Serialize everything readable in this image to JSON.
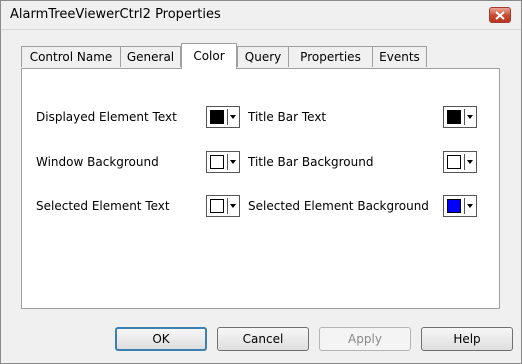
{
  "window": {
    "title": "AlarmTreeViewerCtrl2 Properties"
  },
  "tabs": [
    {
      "label": "Control Name"
    },
    {
      "label": "General"
    },
    {
      "label": "Color"
    },
    {
      "label": "Query"
    },
    {
      "label": "Properties"
    },
    {
      "label": "Events"
    }
  ],
  "active_tab": "Color",
  "colors": [
    {
      "label": "Displayed Element Text",
      "value": "#000000"
    },
    {
      "label": "Window Background",
      "value": "#ffffff"
    },
    {
      "label": "Selected Element Text",
      "value": "#ffffff"
    },
    {
      "label": "Title Bar Text",
      "value": "#000000"
    },
    {
      "label": "Title Bar Background",
      "value": "#ffffff"
    },
    {
      "label": "Selected Element Background",
      "value": "#0000ff"
    }
  ],
  "buttons": {
    "ok": "OK",
    "cancel": "Cancel",
    "apply": "Apply",
    "help": "Help"
  }
}
